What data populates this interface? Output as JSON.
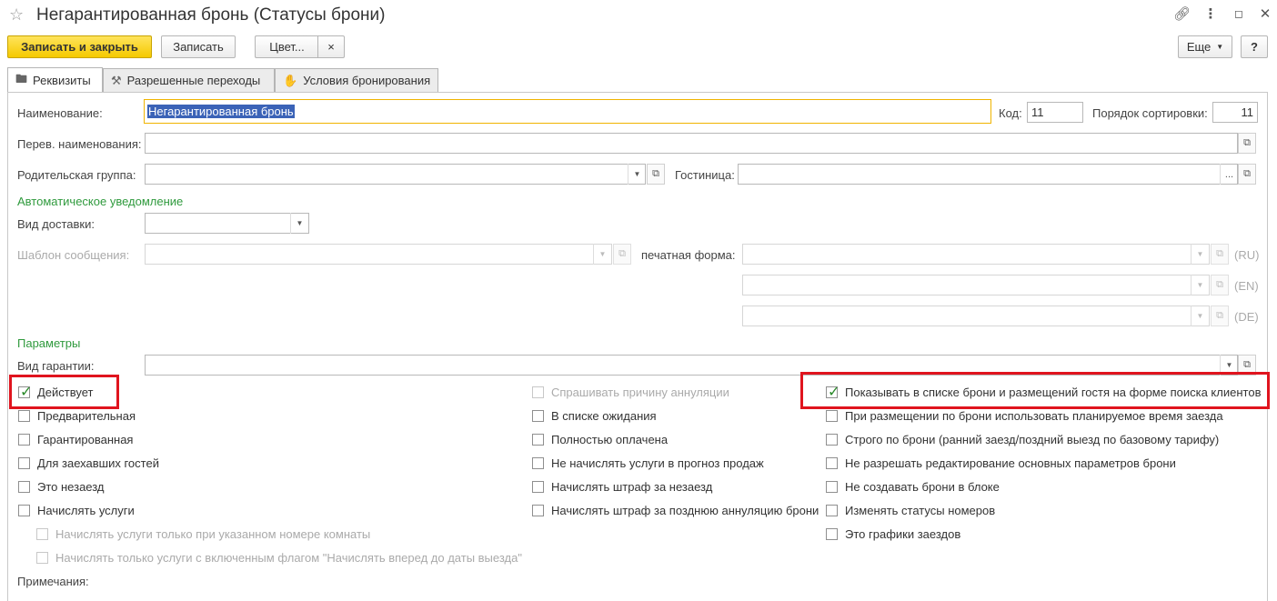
{
  "window": {
    "title": "Негарантированная бронь (Статусы брони)",
    "controls": [
      "link-icon",
      "more-icon",
      "maximize-icon",
      "close-icon"
    ]
  },
  "toolbar": {
    "save_close": "Записать и закрыть",
    "save": "Записать",
    "color": "Цвет...",
    "color_clear": "×",
    "more": "Еще",
    "help": "?"
  },
  "tabs": [
    {
      "label": "Реквизиты",
      "icon": "requisites-icon",
      "active": true
    },
    {
      "label": "Разрешенные переходы",
      "icon": "transitions-icon",
      "active": false
    },
    {
      "label": "Условия бронирования",
      "icon": "handshake-icon",
      "active": false
    }
  ],
  "form": {
    "name_label": "Наименование:",
    "name_value": "Негарантированная бронь",
    "code_label": "Код:",
    "code_value": "11",
    "sort_label": "Порядок сортировки:",
    "sort_value": "11",
    "trans_name_label": "Перев. наименования:",
    "trans_name_value": "",
    "parent_label": "Родительская группа:",
    "parent_value": "",
    "hotel_label": "Гостиница:",
    "hotel_value": "",
    "auto_notify_group": "Автоматическое уведомление",
    "delivery_label": "Вид доставки:",
    "delivery_value": "",
    "template_label": "Шаблон сообщения:",
    "template_value": "",
    "print_form_label": "печатная форма:",
    "lang_ru": "(RU)",
    "lang_en": "(EN)",
    "lang_de": "(DE)",
    "params_group": "Параметры",
    "guarantee_label": "Вид гарантии:",
    "guarantee_value": "",
    "notes_label": "Примечания:"
  },
  "checkboxes": {
    "col1": [
      {
        "label": "Действует",
        "checked": true,
        "enabled": true
      },
      {
        "label": "Предварительная",
        "checked": false,
        "enabled": true
      },
      {
        "label": "Гарантированная",
        "checked": false,
        "enabled": true
      },
      {
        "label": "Для заехавших гостей",
        "checked": false,
        "enabled": true
      },
      {
        "label": "Это незаезд",
        "checked": false,
        "enabled": true
      },
      {
        "label": "Начислять услуги",
        "checked": false,
        "enabled": true
      }
    ],
    "col1_sub": [
      {
        "label": "Начислять услуги только при указанном номере комнаты",
        "checked": false,
        "enabled": false
      },
      {
        "label": "Начислять только услуги с включенным флагом \"Начислять вперед до даты выезда\"",
        "checked": false,
        "enabled": false
      }
    ],
    "col2": [
      {
        "label": "Спрашивать причину аннуляции",
        "checked": false,
        "enabled": false
      },
      {
        "label": "В списке ожидания",
        "checked": false,
        "enabled": true
      },
      {
        "label": "Полностью оплачена",
        "checked": false,
        "enabled": true
      },
      {
        "label": "Не начислять услуги в прогноз продаж",
        "checked": false,
        "enabled": true
      },
      {
        "label": "Начислять штраф за незаезд",
        "checked": false,
        "enabled": true
      },
      {
        "label": "Начислять штраф за позднюю аннуляцию брони",
        "checked": false,
        "enabled": true
      }
    ],
    "col3": [
      {
        "label": "Показывать в списке брони и размещений гостя на форме поиска клиентов",
        "checked": true,
        "enabled": true
      },
      {
        "label": "При размещении по брони использовать планируемое время заезда",
        "checked": false,
        "enabled": true
      },
      {
        "label": "Строго по брони (ранний заезд/поздний выезд по базовому тарифу)",
        "checked": false,
        "enabled": true
      },
      {
        "label": "Не разрешать редактирование основных параметров брони",
        "checked": false,
        "enabled": true
      },
      {
        "label": "Не создавать брони в блоке",
        "checked": false,
        "enabled": true
      },
      {
        "label": "Изменять статусы номеров",
        "checked": false,
        "enabled": true
      },
      {
        "label": "Это графики заездов",
        "checked": false,
        "enabled": true
      }
    ]
  },
  "colors": {
    "primary_button": "#f5c900",
    "group_header": "#2f9a3d",
    "highlight_box": "#e0141e",
    "checkmark": "#2a8a2a",
    "selection": "#3b63b7"
  }
}
